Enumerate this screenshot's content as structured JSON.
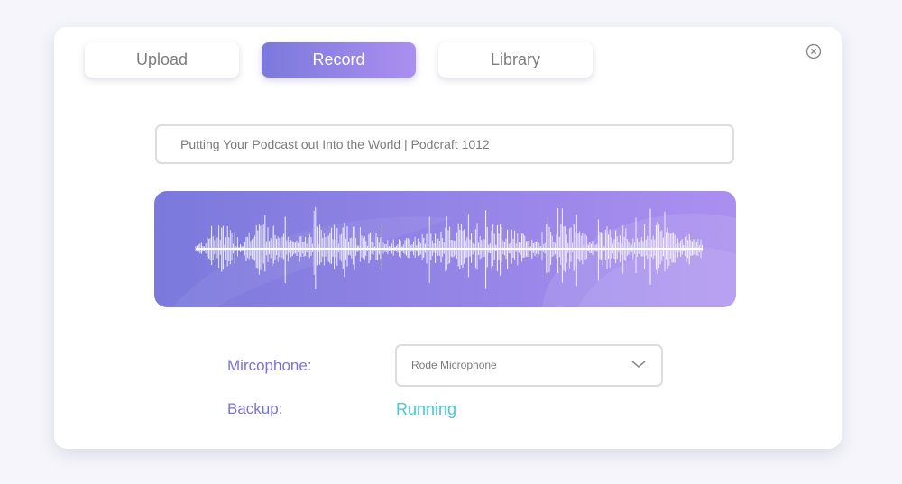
{
  "tabs": {
    "upload_label": "Upload",
    "record_label": "Record",
    "library_label": "Library",
    "active": "Record"
  },
  "episode": {
    "title": "Putting Your Podcast out Into the World | Podcraft 1012"
  },
  "microphone": {
    "label": "Mircophone:",
    "selected": "Rode Microphone"
  },
  "backup": {
    "label": "Backup:",
    "status": "Running"
  },
  "icons": {
    "close": "close-circle-icon",
    "dropdown": "chevron-down-icon"
  },
  "colors": {
    "accent_start": "#7b79dc",
    "accent_end": "#ab8ff0",
    "label_color": "#7a73d6",
    "status_color": "#47c6d6",
    "waveform": "#ffffff"
  }
}
